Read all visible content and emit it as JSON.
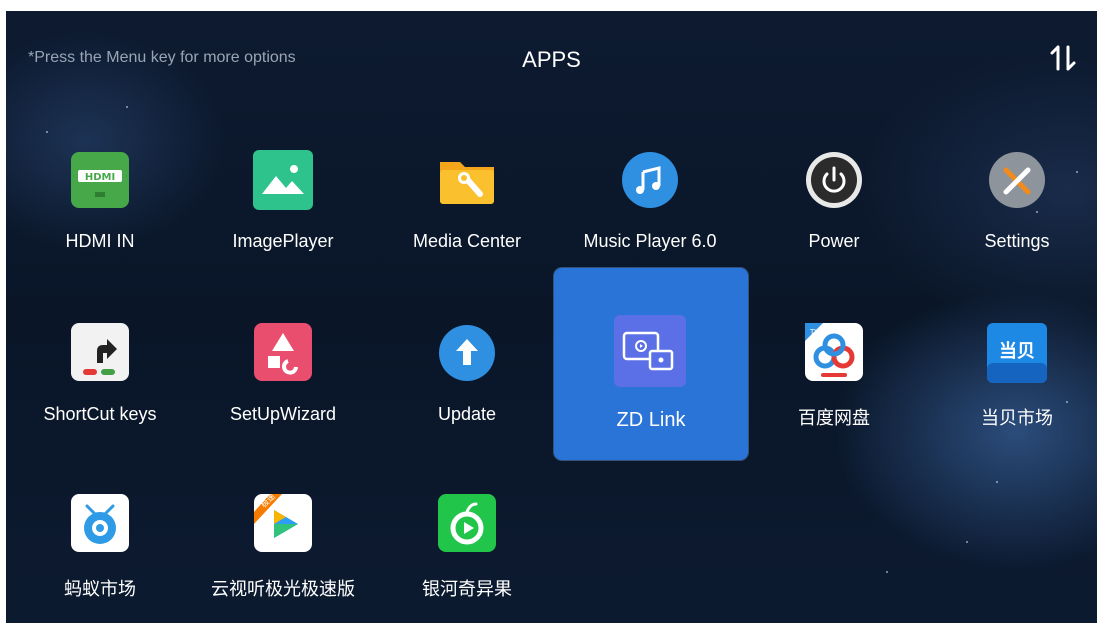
{
  "header": {
    "hint": "*Press the Menu key for more options",
    "title": "APPS",
    "sort_icon": "sort-arrows-icon"
  },
  "apps": [
    {
      "label": "HDMI IN",
      "icon": "hdmi-icon"
    },
    {
      "label": "ImagePlayer",
      "icon": "image-icon"
    },
    {
      "label": "Media Center",
      "icon": "folder-tools-icon"
    },
    {
      "label": "Music Player 6.0",
      "icon": "music-note-icon"
    },
    {
      "label": "Power",
      "icon": "power-icon"
    },
    {
      "label": "Settings",
      "icon": "wrench-screwdriver-icon"
    },
    {
      "label": "ShortCut keys",
      "icon": "shortcut-arrow-icon"
    },
    {
      "label": "SetUpWizard",
      "icon": "shapes-icon"
    },
    {
      "label": "Update",
      "icon": "arrow-up-icon"
    },
    {
      "label": "ZD Link",
      "icon": "screen-cast-icon",
      "focused": true
    },
    {
      "label": "百度网盘",
      "icon": "baidu-cloud-icon"
    },
    {
      "label": "当贝市场",
      "icon": "dangbei-icon"
    },
    {
      "label": "蚂蚁市场",
      "icon": "ant-market-icon"
    },
    {
      "label": "云视听极光极速版",
      "icon": "video-play-icon",
      "badge": "极速"
    },
    {
      "label": "银河奇异果",
      "icon": "kiwi-fruit-icon"
    }
  ],
  "colors": {
    "background": "#0a1628",
    "focus": "#2a73d7",
    "hint_text": "#9aa4b4"
  }
}
